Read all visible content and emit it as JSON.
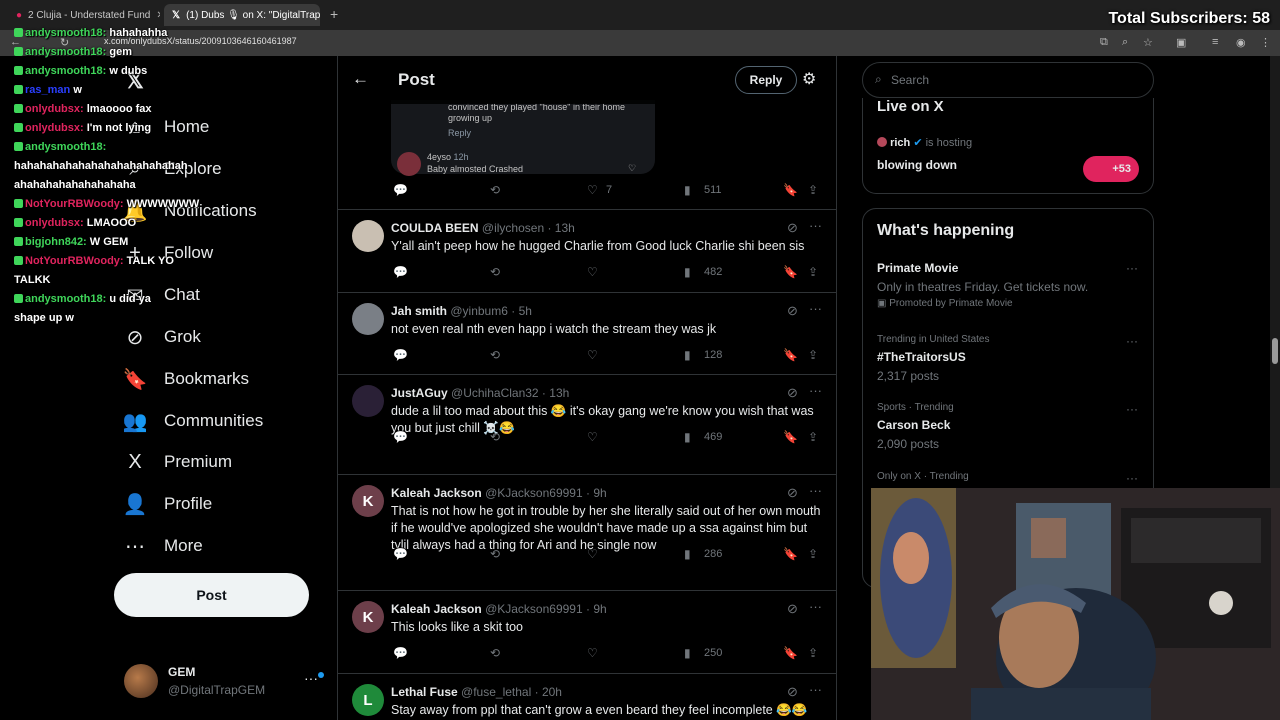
{
  "browser": {
    "tabs": [
      {
        "label": "2 Clujia - Understated Fund"
      },
      {
        "label": "(1) Dubs 🎙 on X: \"DigitalTrapGEM\""
      }
    ],
    "url": "x.com/onlydubsX/status/2009103646160461987"
  },
  "overlay": {
    "subscribers": "Total Subscribers: 58"
  },
  "chat": [
    {
      "user": "andysmooth18:",
      "msg": "hahahahha",
      "color": "#3fd65a"
    },
    {
      "user": "andysmooth18:",
      "msg": "gem",
      "color": "#3fd65a"
    },
    {
      "user": "andysmooth18:",
      "msg": "w dubs",
      "color": "#3fd65a"
    },
    {
      "user": "ras_man",
      "msg": "w",
      "color": "#2a3fff"
    },
    {
      "user": "onlydubsx:",
      "msg": "lmaoooo fax",
      "color": "#e0245e"
    },
    {
      "user": "onlydubsx:",
      "msg": "I'm not lying",
      "color": "#e0245e"
    },
    {
      "user": "andysmooth18:",
      "msg": "",
      "color": "#3fd65a"
    },
    {
      "user": "",
      "msg": "hahahahahahahahahahahahahah",
      "color": "#fff"
    },
    {
      "user": "",
      "msg": "ahahahahahahahahaha",
      "color": "#fff"
    },
    {
      "user": "NotYourRBWoody:",
      "msg": "WWWWWWW",
      "color": "#e0245e"
    },
    {
      "user": "onlydubsx:",
      "msg": "LMAOOO",
      "color": "#e0245e"
    },
    {
      "user": "bigjohn842:",
      "msg": "W GEM",
      "color": "#3fd65a"
    },
    {
      "user": "NotYourRBWoody:",
      "msg": "TALK YO",
      "color": "#e0245e"
    },
    {
      "user": "",
      "msg": "TALKK",
      "color": "#fff"
    },
    {
      "user": "andysmooth18:",
      "msg": "u did ya",
      "color": "#3fd65a"
    },
    {
      "user": "",
      "msg": "shape up w",
      "color": "#fff"
    }
  ],
  "nav": {
    "items": [
      {
        "label": "Home",
        "icon": "⌂"
      },
      {
        "label": "Explore",
        "icon": "⌕"
      },
      {
        "label": "Notifications",
        "icon": "🔔"
      },
      {
        "label": "Follow",
        "icon": "+"
      },
      {
        "label": "Chat",
        "icon": "✉"
      },
      {
        "label": "Grok",
        "icon": "⊘"
      },
      {
        "label": "Bookmarks",
        "icon": "🔖"
      },
      {
        "label": "Communities",
        "icon": "👥"
      },
      {
        "label": "Premium",
        "icon": "X"
      },
      {
        "label": "Profile",
        "icon": "👤"
      },
      {
        "label": "More",
        "icon": "⋯"
      }
    ],
    "post_label": "Post",
    "account": {
      "name": "GEM",
      "handle": "@DigitalTrapGEM"
    }
  },
  "header": {
    "title": "Post",
    "reply_label": "Reply"
  },
  "embed": {
    "text": "convinced they played \"house\" in their home growing up",
    "reply": "Reply",
    "sub_user": "4eyso",
    "sub_time": "12h",
    "sub_text": "Baby almosted Crashed"
  },
  "first_actions": {
    "likes": "7",
    "views": "511"
  },
  "tweets": [
    {
      "name": "COULDA BEEN",
      "handle": "@ilychosen",
      "time": "13h",
      "text": "Y'all ain't peep how he hugged Charlie from Good luck Charlie shi been sis",
      "views": "482",
      "avatar": "",
      "avatar_color": "#c9bfb2"
    },
    {
      "name": "Jah smith",
      "handle": "@yinbum6",
      "time": "5h",
      "text": "not even real nth even happ i watch the stream they was jk",
      "views": "128",
      "avatar": "",
      "avatar_color": "#7a7f86"
    },
    {
      "name": "JustAGuy",
      "handle": "@UchihaClan32",
      "time": "13h",
      "text": "dude a lil too mad about this 😂 it's okay gang we're know you wish that was you but just chill ☠️😂",
      "views": "469",
      "avatar": "",
      "avatar_color": "#2a2036"
    },
    {
      "name": "Kaleah Jackson",
      "handle": "@KJackson69991",
      "time": "9h",
      "text": "That is not how he got in trouble by her she literally said out of her own mouth if he would've apologized she wouldn't have made up a ssa against him but tylil always had a thing for Ari and he single now",
      "views": "286",
      "avatar": "K",
      "avatar_color": "#6d3f4a"
    },
    {
      "name": "Kaleah Jackson",
      "handle": "@KJackson69991",
      "time": "9h",
      "text": "This looks like a skit too",
      "views": "250",
      "avatar": "K",
      "avatar_color": "#6d3f4a"
    },
    {
      "name": "Lethal Fuse",
      "handle": "@fuse_lethal",
      "time": "20h",
      "text": "Stay away from ppl that can't grow a even beard they feel incomplete 😂😂",
      "views": "",
      "avatar": "L",
      "avatar_color": "#1f8a3a"
    }
  ],
  "sidebar": {
    "search_placeholder": "Search",
    "live_title": "Live on X",
    "live_host": "rich",
    "live_hosting": "is hosting",
    "live_topic": "blowing down",
    "live_count": "+53",
    "happening_title": "What's happening",
    "trends": [
      {
        "context": "",
        "title": "Primate Movie",
        "desc": "Only in theatres Friday. Get tickets now.",
        "promo": "Promoted by Primate Movie"
      },
      {
        "context": "Trending in United States",
        "title": "#TheTraitorsUS",
        "desc": "2,317 posts",
        "promo": ""
      },
      {
        "context": "Sports · Trending",
        "title": "Carson Beck",
        "desc": "2,090 posts",
        "promo": ""
      },
      {
        "context": "Only on X · Trending",
        "title": "",
        "desc": "",
        "promo": ""
      }
    ]
  }
}
